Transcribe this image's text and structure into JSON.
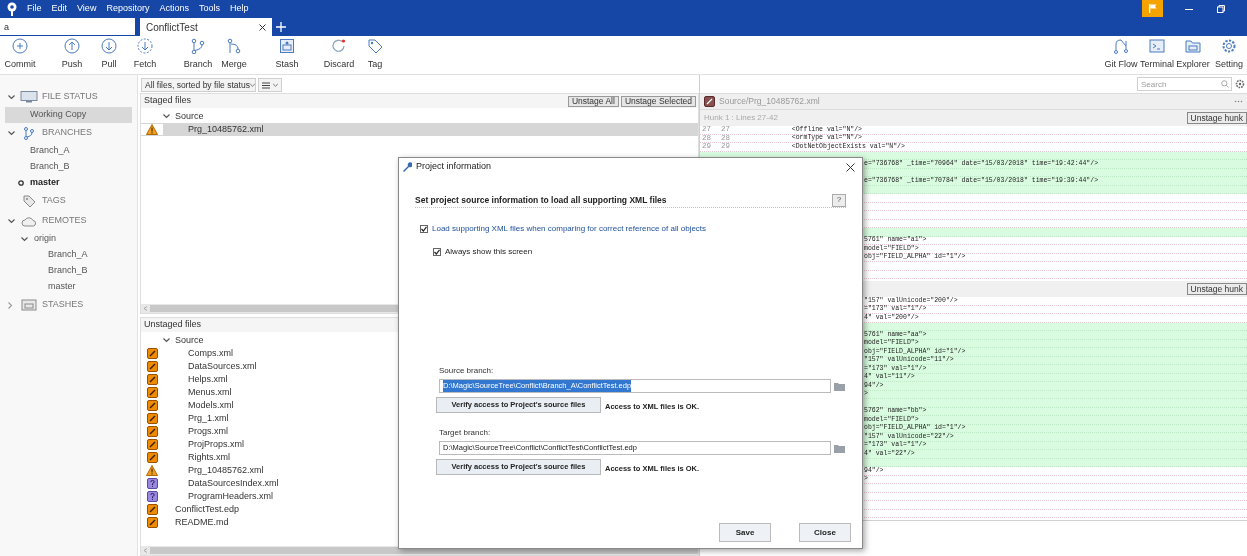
{
  "app_menu": [
    "File",
    "Edit",
    "View",
    "Repository",
    "Actions",
    "Tools",
    "Help"
  ],
  "repo_search": {
    "value": "a"
  },
  "tabs": [
    {
      "label": "ConflictTest",
      "selected": true
    }
  ],
  "toolbar_left": [
    "Commit",
    "Push",
    "Pull",
    "Fetch",
    "Branch",
    "Merge",
    "Stash",
    "Discard",
    "Tag"
  ],
  "toolbar_right": [
    "Git Flow",
    "Terminal",
    "Explorer",
    "Setting"
  ],
  "sidebar": [
    {
      "label": "FILE STATUS",
      "expanded": true,
      "items": [
        {
          "label": "Working Copy",
          "selected": true
        }
      ]
    },
    {
      "label": "BRANCHES",
      "expanded": true,
      "items": [
        {
          "label": "Branch_A",
          "selected": false,
          "current": false
        },
        {
          "label": "Branch_B",
          "selected": false,
          "current": false
        },
        {
          "label": "master",
          "selected": false,
          "current": true
        }
      ]
    },
    {
      "label": "TAGS"
    },
    {
      "label": "REMOTES",
      "expanded": true,
      "items": [
        {
          "label": "origin",
          "selected": false,
          "expanded": true,
          "children": [
            {
              "label": "Branch_A",
              "selected": false
            },
            {
              "label": "Branch_B",
              "selected": false
            },
            {
              "label": "master",
              "selected": false
            }
          ]
        }
      ]
    },
    {
      "label": "STASHES",
      "expanded": false
    }
  ],
  "file_filter": {
    "label": "All files, sorted by file status"
  },
  "staged": {
    "title": "Staged files",
    "buttons": [
      "Unstage All",
      "Unstage Selected"
    ],
    "tree": [
      {
        "label": "Source",
        "expanded": true,
        "selected": false,
        "children": [
          {
            "label": "Prg_10485762.xml",
            "kind": "conflict",
            "selected": true
          }
        ]
      }
    ]
  },
  "unstaged": {
    "title": "Unstaged files",
    "tree": [
      {
        "label": "Source",
        "expanded": true,
        "selected": false,
        "children": [
          {
            "label": "Comps.xml",
            "kind": "modified",
            "selected": false
          },
          {
            "label": "DataSources.xml",
            "kind": "modified",
            "selected": false
          },
          {
            "label": "Helps.xml",
            "kind": "modified",
            "selected": false
          },
          {
            "label": "Menus.xml",
            "kind": "modified",
            "selected": false
          },
          {
            "label": "Models.xml",
            "kind": "modified",
            "selected": false
          },
          {
            "label": "Prg_1.xml",
            "kind": "modified",
            "selected": false
          },
          {
            "label": "Progs.xml",
            "kind": "modified",
            "selected": false
          },
          {
            "label": "ProjProps.xml",
            "kind": "modified",
            "selected": false
          },
          {
            "label": "Rights.xml",
            "kind": "modified",
            "selected": false
          },
          {
            "label": "Prg_10485762.xml",
            "kind": "conflict",
            "selected": false
          },
          {
            "label": "DataSourcesIndex.xml",
            "kind": "untracked",
            "selected": false
          },
          {
            "label": "ProgramHeaders.xml",
            "kind": "untracked",
            "selected": false
          }
        ]
      },
      {
        "label": "ConflictTest.edp",
        "kind": "modified",
        "selected": false
      },
      {
        "label": "README.md",
        "kind": "modified",
        "selected": false
      }
    ]
  },
  "diff": {
    "search": {
      "placeholder": "Search"
    },
    "file_path": "Source/Prg_10485762.xml",
    "hunks": [
      {
        "title": "Hunk 1 : Lines 27-42",
        "button": "Unstage hunk",
        "lines": [
          {
            "kind": "context",
            "old": "27",
            "new": "27",
            "text": "            <Offline val=\"N\"/>"
          },
          {
            "kind": "context",
            "old": "28",
            "new": "28",
            "text": "            <ormType val=\"N\"/>"
          },
          {
            "kind": "context",
            "old": "29",
            "new": "29",
            "text": "            <DotNetObjectExists val=\"N\"/>"
          },
          {
            "kind": "added"
          },
          {
            "kind": "added",
            "cut": true,
            "text": "e=\"736768\" _time=\"70964\" date=\"15/03/2018\" time=\"19:42:44\"/>"
          },
          {
            "kind": "added"
          },
          {
            "kind": "added",
            "cut": true,
            "text": "e=\"736768\" _time=\"70784\" date=\"15/03/2018\" time=\"19:39:44\"/>"
          },
          {
            "kind": "added"
          },
          {
            "kind": "context"
          },
          {
            "kind": "context"
          },
          {
            "kind": "context"
          },
          {
            "kind": "context"
          },
          {
            "kind": "added"
          },
          {
            "kind": "context",
            "cut": true,
            "text": "5761\" name=\"a1\">"
          },
          {
            "kind": "context",
            "cut": true,
            "text": "model=\"FIELD\">"
          },
          {
            "kind": "context",
            "cut": true,
            "text": "obj=\"FIELD_ALPHA\" id=\"1\"/>"
          },
          {
            "kind": "context"
          },
          {
            "kind": "context"
          }
        ]
      },
      {
        "button": "Unstage hunk",
        "lines": [
          {
            "kind": "context",
            "cut": true,
            "text": "\"157\" valUnicode=\"200\"/>"
          },
          {
            "kind": "context",
            "cut": true,
            "text": "=\"173\" val=\"1\"/>"
          },
          {
            "kind": "context",
            "cut": true,
            "text": "4\" val=\"200\"/>"
          },
          {
            "kind": "added"
          },
          {
            "kind": "added",
            "cut": true,
            "text": "5761\" name=\"aa\">"
          },
          {
            "kind": "added",
            "cut": true,
            "text": "model=\"FIELD\">"
          },
          {
            "kind": "added",
            "cut": true,
            "text": "obj=\"FIELD_ALPHA\" id=\"1\"/>"
          },
          {
            "kind": "added",
            "cut": true,
            "text": "\"157\" valUnicode=\"11\"/>"
          },
          {
            "kind": "added",
            "cut": true,
            "text": "=\"173\" val=\"1\"/>"
          },
          {
            "kind": "added",
            "cut": true,
            "text": "4\" val=\"11\"/>"
          },
          {
            "kind": "added",
            "cut": true,
            "text": "94\"/>"
          },
          {
            "kind": "added",
            "cut": true,
            "text": ">"
          },
          {
            "kind": "added"
          },
          {
            "kind": "added",
            "cut": true,
            "text": "5762\" name=\"bb\">"
          },
          {
            "kind": "added",
            "cut": true,
            "text": "model=\"FIELD\">"
          },
          {
            "kind": "added",
            "cut": true,
            "text": "obj=\"FIELD_ALPHA\" id=\"1\"/>"
          },
          {
            "kind": "added",
            "cut": true,
            "text": "\"157\" valUnicode=\"22\"/>"
          },
          {
            "kind": "added",
            "cut": true,
            "text": "=\"173\" val=\"1\"/>"
          },
          {
            "kind": "added",
            "cut": true,
            "text": "4\" val=\"22\"/>"
          },
          {
            "kind": "added"
          },
          {
            "kind": "context",
            "cut": true,
            "text": "94\"/>"
          },
          {
            "kind": "context",
            "cut": true,
            "text": ">"
          },
          {
            "kind": "context"
          },
          {
            "kind": "context"
          },
          {
            "kind": "context"
          },
          {
            "kind": "context"
          }
        ]
      }
    ]
  },
  "dialog": {
    "title": "Project information",
    "heading": "Set project source information to load all supporting XML files",
    "help": "?",
    "options": [
      {
        "label": "Load supporting XML files when comparing for correct reference of all objects",
        "checked": true
      },
      {
        "label": "Always show this screen",
        "checked": true
      }
    ],
    "branches": [
      {
        "label": "Source branch:",
        "value": "D:\\Magic\\SourceTree\\Conflict\\Branch_A\\ConflictTest.edp",
        "selected": true,
        "button": "Verify access to Project's source files",
        "status": "Access to XML files is OK."
      },
      {
        "label": "Target branch:",
        "value": "D:\\Magic\\SourceTree\\Conflict\\ConflictTest\\ConflictTest.edp",
        "selected": false,
        "button": "Verify access to Project's source files",
        "status": "Access to XML files is OK."
      }
    ],
    "buttons": [
      "Save",
      "Close"
    ]
  }
}
